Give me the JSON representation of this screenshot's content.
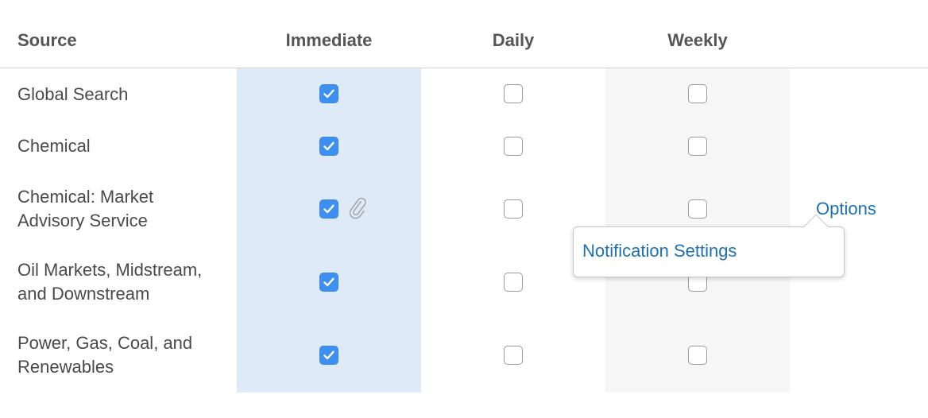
{
  "table": {
    "headers": {
      "source": "Source",
      "immediate": "Immediate",
      "daily": "Daily",
      "weekly": "Weekly"
    },
    "rows": [
      {
        "lines": [
          "Global Search"
        ],
        "immediate": true,
        "daily": false,
        "weekly": false
      },
      {
        "lines": [
          "Chemical"
        ],
        "immediate": true,
        "daily": false,
        "weekly": false
      },
      {
        "lines": [
          "Chemical: Market",
          "Advisory Service"
        ],
        "immediate": true,
        "daily": false,
        "weekly": false,
        "attachment_icon": "paperclip-icon"
      },
      {
        "lines": [
          "Oil Markets, Midstream,",
          "and Downstream"
        ],
        "immediate": true,
        "daily": false,
        "weekly": false
      },
      {
        "lines": [
          "Power, Gas, Coal, and",
          "Renewables"
        ],
        "immediate": true,
        "daily": false,
        "weekly": false
      }
    ]
  },
  "options": {
    "label": "Options",
    "popover_item": "Notification Settings"
  },
  "colors": {
    "accent": "#3d8ff0",
    "link": "#1f6fb5",
    "immediate_column_bg": "#dfeaf8",
    "weekly_column_bg": "#f6f6f6"
  }
}
